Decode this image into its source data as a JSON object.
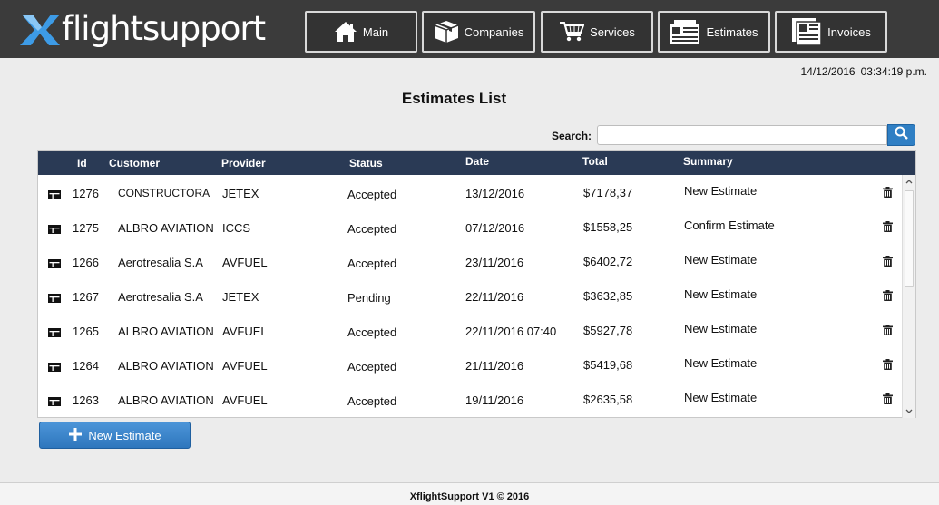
{
  "app": {
    "logo": {
      "x": "X",
      "part1": "flight",
      "part2": "support"
    },
    "nav": [
      {
        "label": "Main",
        "icon": "home-icon"
      },
      {
        "label": "Companies",
        "icon": "box-icon"
      },
      {
        "label": "Services",
        "icon": "cart-icon"
      },
      {
        "label": "Estimates",
        "icon": "estimate-icon"
      },
      {
        "label": "Invoices",
        "icon": "invoice-icon"
      }
    ],
    "datetime": {
      "date": "14/12/2016",
      "time": "03:34:19 p.m."
    }
  },
  "page": {
    "title": "Estimates List",
    "search": {
      "label": "Search:",
      "value": "",
      "placeholder": "",
      "icon": "search-icon"
    }
  },
  "table": {
    "columns": [
      "Id",
      "Customer",
      "Provider",
      "Status",
      "Date",
      "Total",
      "Summary"
    ],
    "rows": [
      {
        "id": "1276",
        "customer": "CONSTRUCTORA",
        "provider": "JETEX",
        "status": "Accepted",
        "date": "13/12/2016",
        "total": "$7178,37",
        "summary": "New Estimate"
      },
      {
        "id": "1275",
        "customer": "ALBRO AVIATION",
        "provider": "ICCS",
        "status": "Accepted",
        "date": "07/12/2016",
        "total": "$1558,25",
        "summary": "Confirm Estimate"
      },
      {
        "id": "1266",
        "customer": "Aerotresalia S.A",
        "provider": "AVFUEL",
        "status": "Accepted",
        "date": "23/11/2016",
        "total": "$6402,72",
        "summary": "New Estimate"
      },
      {
        "id": "1267",
        "customer": "Aerotresalia S.A",
        "provider": "JETEX",
        "status": "Pending",
        "date": "22/11/2016",
        "total": "$3632,85",
        "summary": "New Estimate"
      },
      {
        "id": "1265",
        "customer": "ALBRO AVIATION",
        "provider": "AVFUEL",
        "status": "Accepted",
        "date": "22/11/2016 07:40",
        "total": "$5927,78",
        "summary": "New Estimate"
      },
      {
        "id": "1264",
        "customer": "ALBRO AVIATION",
        "provider": "AVFUEL",
        "status": "Accepted",
        "date": "21/11/2016",
        "total": "$5419,68",
        "summary": "New Estimate"
      },
      {
        "id": "1263",
        "customer": "ALBRO AVIATION",
        "provider": "AVFUEL",
        "status": "Accepted",
        "date": "19/11/2016",
        "total": "$2635,58",
        "summary": "New Estimate"
      }
    ],
    "row_icon": "view-icon",
    "delete_icon": "trash-icon"
  },
  "actions": {
    "new_estimate": "New Estimate",
    "new_icon": "plus-icon"
  },
  "footer": {
    "text": "XflightSupport V1 © 2016"
  },
  "colors": {
    "topbar": "#3b3b3b",
    "header": "#2a3a55",
    "accent": "#2f7fc4",
    "logo_x": "#3d9be6"
  }
}
